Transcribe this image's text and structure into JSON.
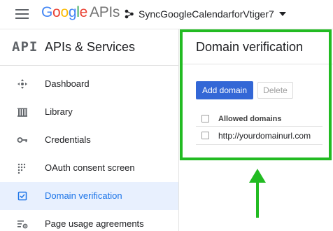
{
  "header": {
    "logo_letters": [
      "G",
      "o",
      "o",
      "g",
      "l",
      "e"
    ],
    "logo_suffix": "APIs",
    "project_name": "SyncGoogleCalendarforVtiger7",
    "icons": {
      "menu": "hamburger-menu-icon",
      "project": "project-dots-icon",
      "dropdown": "caret-down-icon"
    }
  },
  "sidebar": {
    "badge": "API",
    "title": "APIs & Services",
    "items": [
      {
        "label": "Dashboard",
        "icon": "dashboard-icon",
        "active": false
      },
      {
        "label": "Library",
        "icon": "library-icon",
        "active": false
      },
      {
        "label": "Credentials",
        "icon": "key-icon",
        "active": false
      },
      {
        "label": "OAuth consent screen",
        "icon": "oauth-dots-icon",
        "active": false
      },
      {
        "label": "Domain verification",
        "icon": "domain-check-icon",
        "active": true
      },
      {
        "label": "Page usage agreements",
        "icon": "settings-list-icon",
        "active": false
      }
    ]
  },
  "main": {
    "title": "Domain verification",
    "add_button": "Add domain",
    "delete_button": "Delete",
    "table": {
      "header": "Allowed domains",
      "rows": [
        "http://yourdomainurl.com"
      ]
    }
  },
  "colors": {
    "accent_blue": "#1a73e8",
    "button_blue": "#3367d6",
    "active_bg": "#e8f0fe",
    "annotation_green": "#22bb22"
  }
}
